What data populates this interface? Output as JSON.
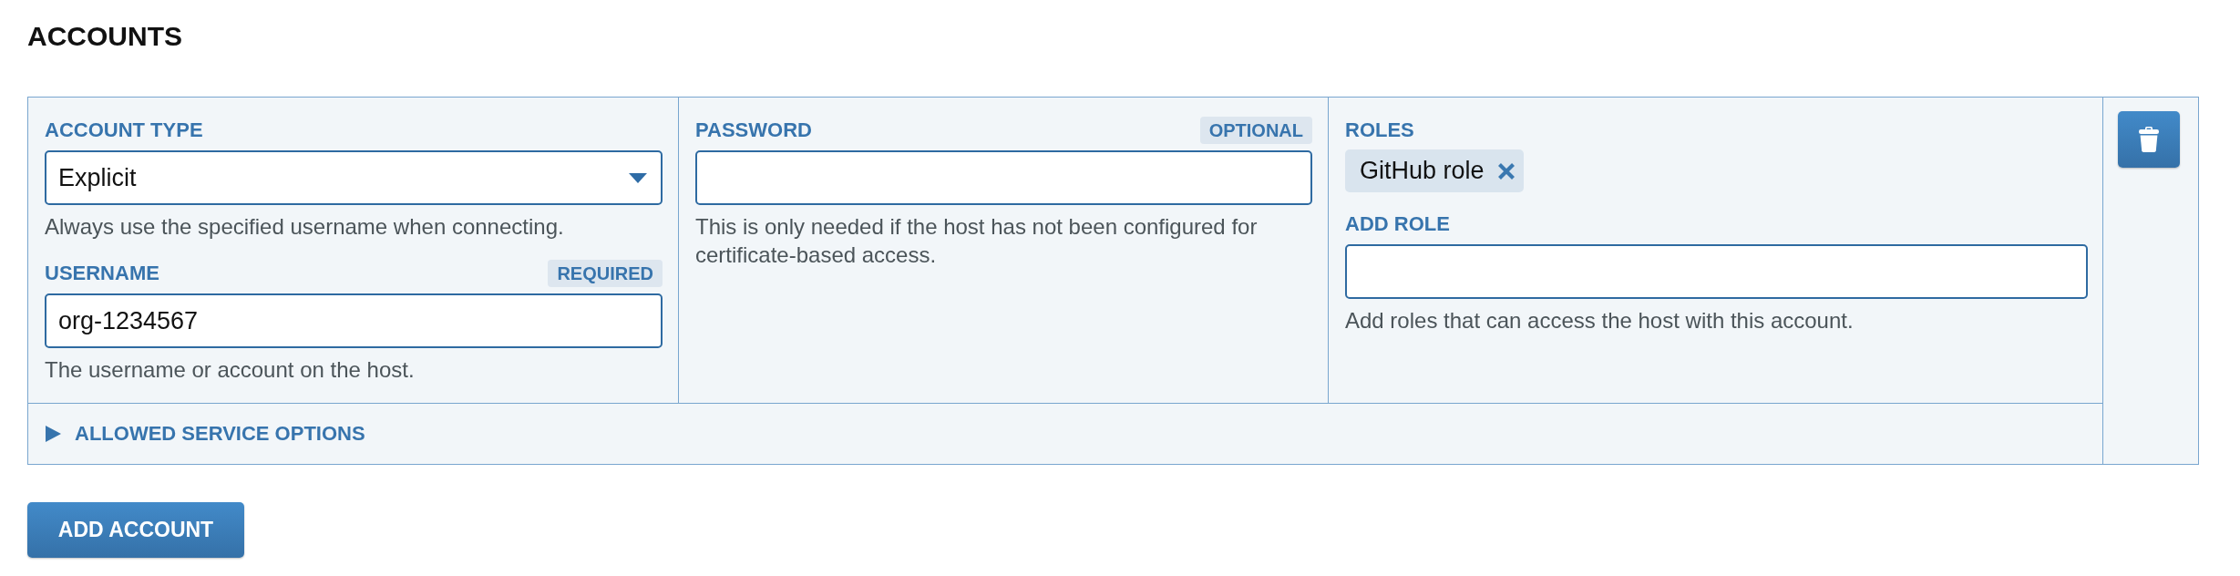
{
  "title": "ACCOUNTS",
  "account": {
    "account_type": {
      "label": "ACCOUNT TYPE",
      "value": "Explicit",
      "help": "Always use the specified username when connecting."
    },
    "username": {
      "label": "USERNAME",
      "badge": "REQUIRED",
      "value": "org-1234567",
      "help": "The username or account on the host."
    },
    "password": {
      "label": "PASSWORD",
      "badge": "OPTIONAL",
      "help": "This is only needed if the host has not been configured for certificate-based access."
    },
    "roles": {
      "label": "ROLES",
      "chips": [
        {
          "label": "GitHub role"
        }
      ]
    },
    "add_role": {
      "label": "ADD ROLE",
      "help": "Add roles that can access the host with this account."
    },
    "service_options": {
      "label": "ALLOWED SERVICE OPTIONS",
      "expanded": false
    }
  },
  "add_button": "ADD ACCOUNT"
}
